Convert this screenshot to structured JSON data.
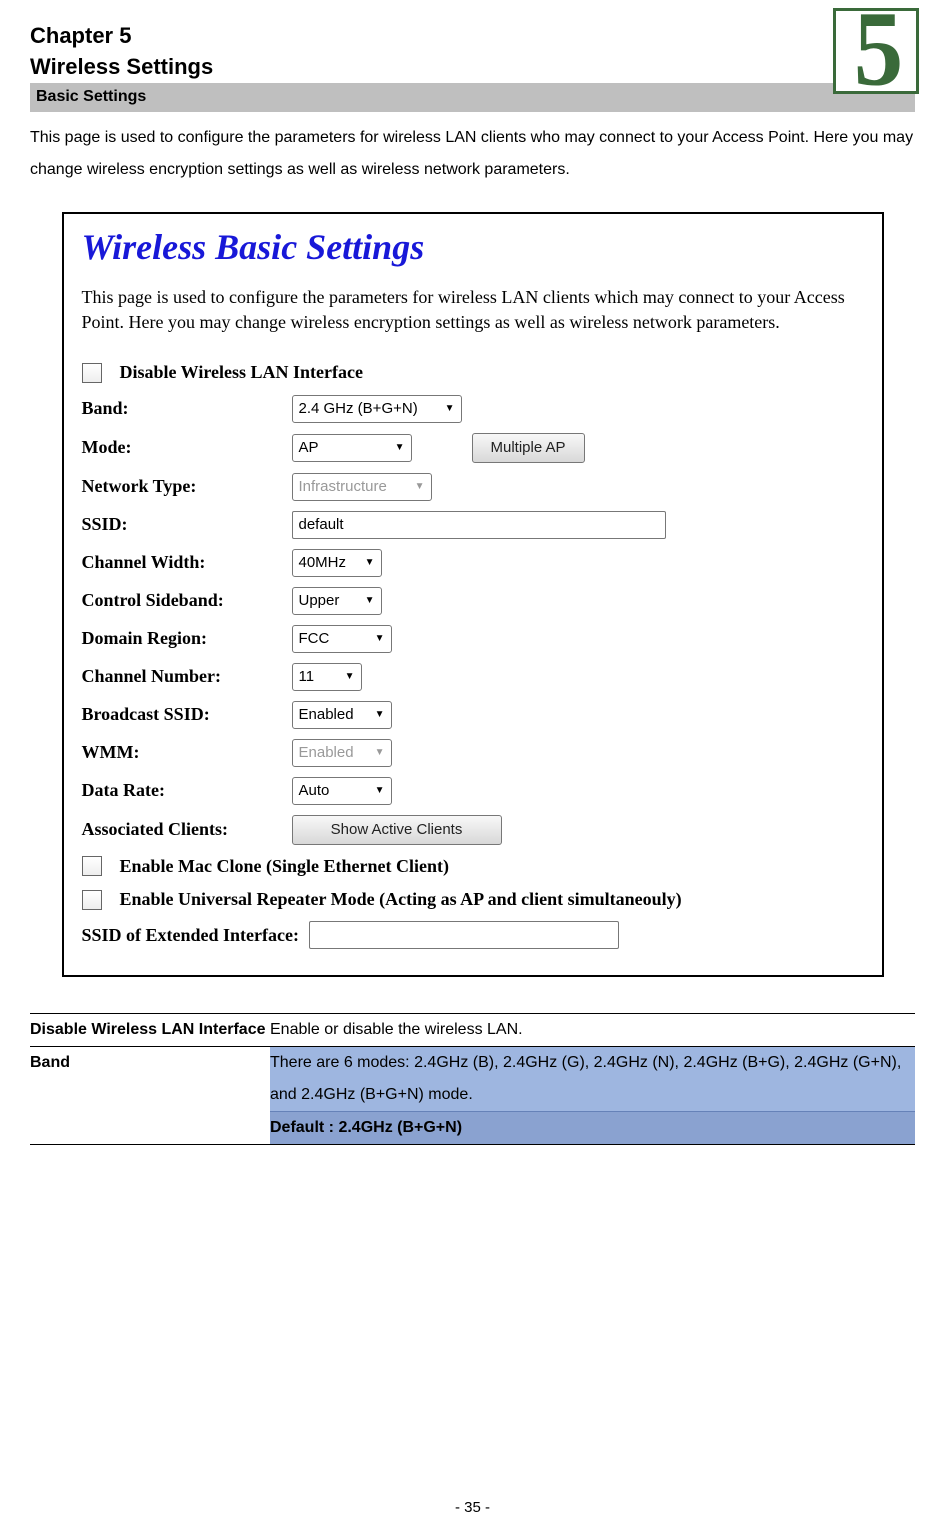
{
  "chapter": {
    "num_line": "Chapter 5",
    "sub_line": "Wireless Settings",
    "section_bar": "Basic Settings",
    "deco_number": "5"
  },
  "intro": "This page is used to configure the parameters for wireless LAN clients who may connect to your Access Point. Here you may change wireless encryption settings as well as wireless network parameters.",
  "screenshot": {
    "title": "Wireless Basic Settings",
    "intro": "This page is used to configure the parameters for wireless LAN clients which may connect to your Access Point. Here you may change wireless encryption settings as well as wireless network parameters.",
    "disable_lan": "Disable Wireless LAN Interface",
    "fields": {
      "band": {
        "label": "Band:",
        "value": "2.4 GHz (B+G+N)"
      },
      "mode": {
        "label": "Mode:",
        "value": "AP",
        "btn": "Multiple AP"
      },
      "nettype": {
        "label": "Network Type:",
        "value": "Infrastructure"
      },
      "ssid": {
        "label": "SSID:",
        "value": "default"
      },
      "width": {
        "label": "Channel Width:",
        "value": "40MHz"
      },
      "sideband": {
        "label": "Control Sideband:",
        "value": "Upper"
      },
      "region": {
        "label": "Domain Region:",
        "value": "FCC"
      },
      "channel": {
        "label": "Channel Number:",
        "value": "11"
      },
      "bssid": {
        "label": "Broadcast SSID:",
        "value": "Enabled"
      },
      "wmm": {
        "label": "WMM:",
        "value": "Enabled"
      },
      "rate": {
        "label": "Data Rate:",
        "value": "Auto"
      },
      "assoc": {
        "label": "Associated Clients:",
        "btn": "Show Active Clients"
      }
    },
    "macclone": "Enable Mac Clone (Single Ethernet Client)",
    "repeater": "Enable Universal Repeater Mode (Acting as AP and client simultaneouly)",
    "extssid_label": "SSID of Extended Interface:",
    "extssid_value": ""
  },
  "params_table": {
    "rows": [
      {
        "name": "Disable Wireless LAN Interface",
        "desc": "Enable or disable the wireless LAN."
      },
      {
        "name": "Band",
        "desc": "There are 6 modes: 2.4GHz (B), 2.4GHz (G), 2.4GHz (N), 2.4GHz (B+G), 2.4GHz (G+N), and 2.4GHz (B+G+N) mode.",
        "default": "Default : 2.4GHz (B+G+N)"
      }
    ]
  },
  "footer": "- 35 -"
}
